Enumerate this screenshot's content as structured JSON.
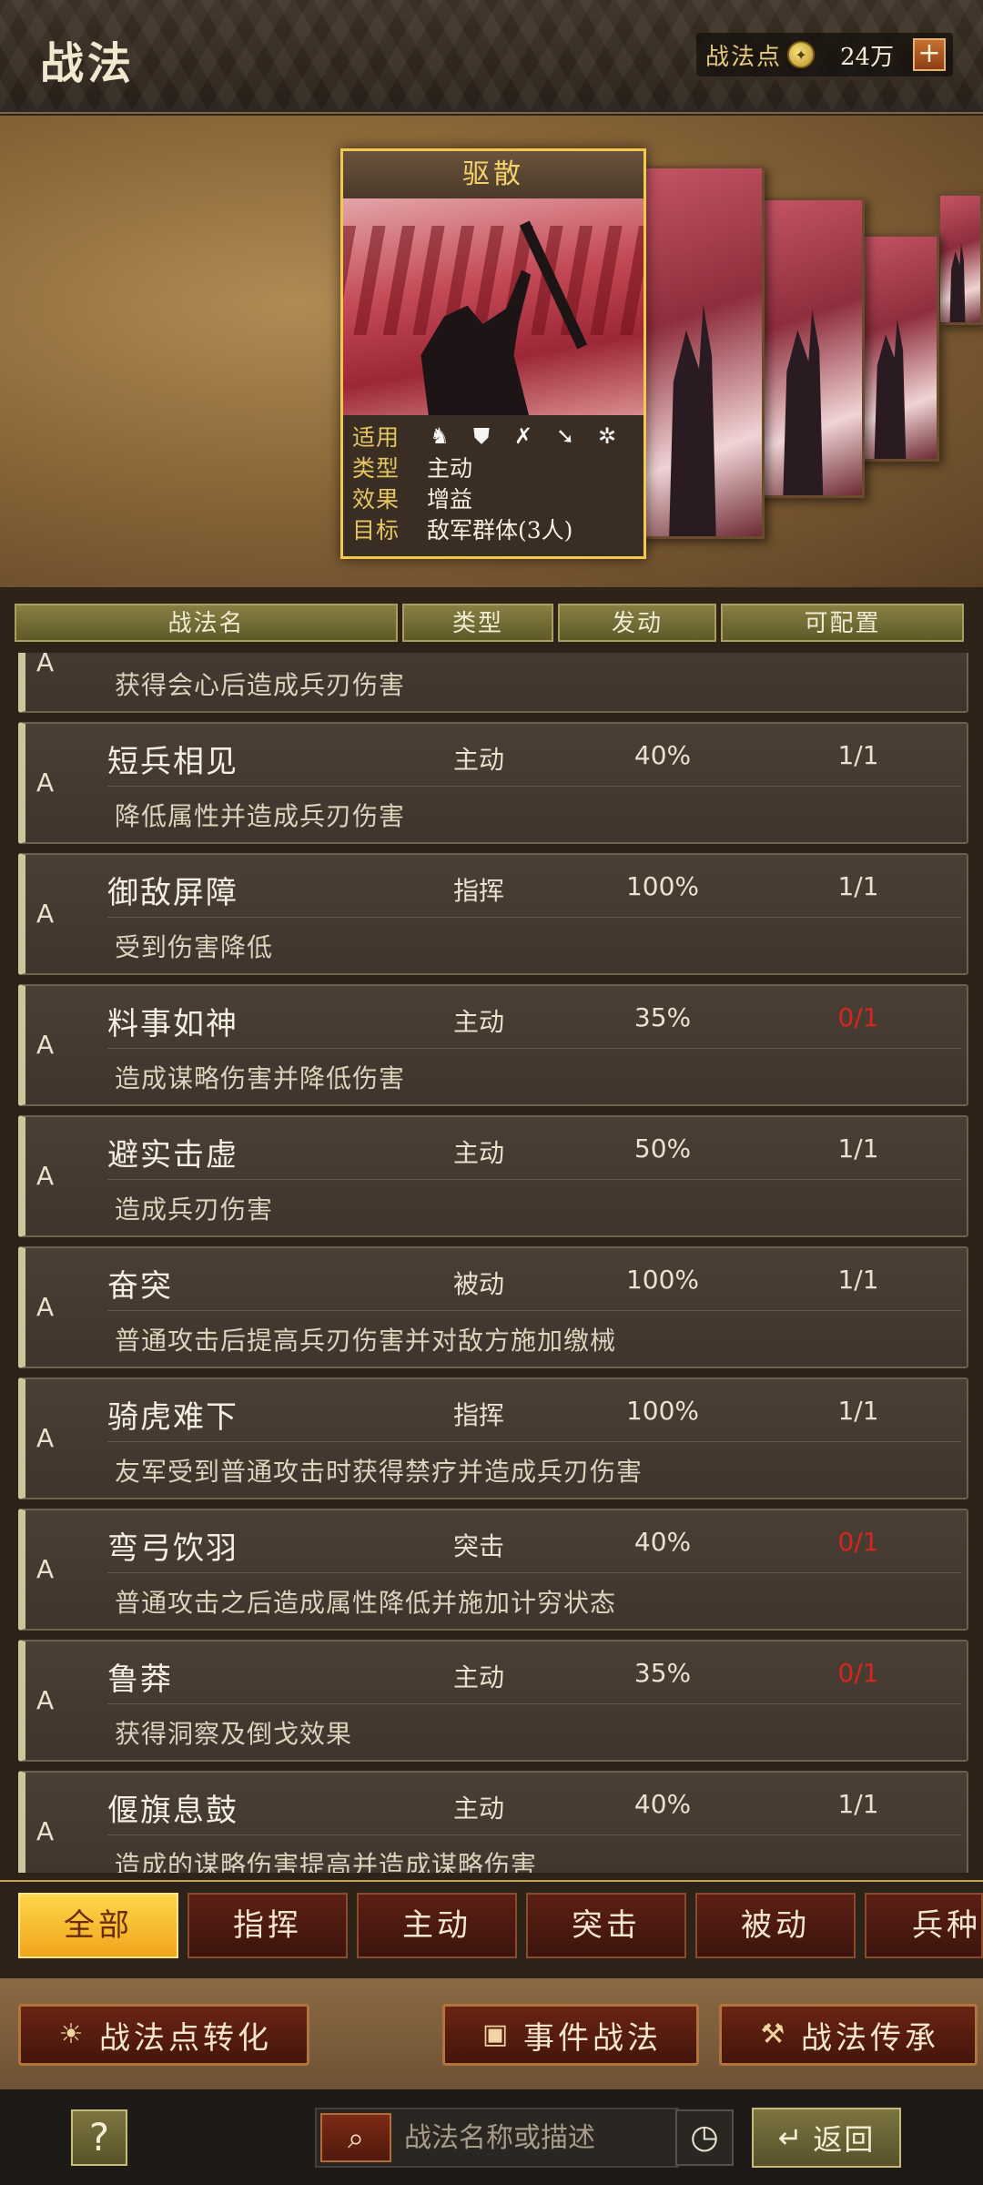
{
  "header": {
    "title": "战法",
    "points_label": "战法点",
    "points_value": "24万",
    "plus_label": "+"
  },
  "card": {
    "name": "驱散",
    "applicable_key": "适用",
    "type_key": "类型",
    "type_value": "主动",
    "effect_key": "效果",
    "effect_value": "增益",
    "target_key": "目标",
    "target_value": "敌军群体(3人)",
    "unit_icons": [
      "cavalry-icon",
      "shield-icon",
      "bow-icon",
      "spear-icon",
      "wheel-icon"
    ]
  },
  "table": {
    "headers": [
      "战法名",
      "类型",
      "发动",
      "可配置"
    ],
    "partial_row": {
      "grade": "A",
      "desc": "获得会心后造成兵刃伤害"
    },
    "rows": [
      {
        "grade": "A",
        "name": "短兵相见",
        "type": "主动",
        "rate": "40%",
        "slots": "1/1",
        "desc": "降低属性并造成兵刃伤害",
        "empty": false
      },
      {
        "grade": "A",
        "name": "御敌屏障",
        "type": "指挥",
        "rate": "100%",
        "slots": "1/1",
        "desc": "受到伤害降低",
        "empty": false
      },
      {
        "grade": "A",
        "name": "料事如神",
        "type": "主动",
        "rate": "35%",
        "slots": "0/1",
        "desc": "造成谋略伤害并降低伤害",
        "empty": true
      },
      {
        "grade": "A",
        "name": "避实击虚",
        "type": "主动",
        "rate": "50%",
        "slots": "1/1",
        "desc": "造成兵刃伤害",
        "empty": false
      },
      {
        "grade": "A",
        "name": "奋突",
        "type": "被动",
        "rate": "100%",
        "slots": "1/1",
        "desc": "普通攻击后提高兵刃伤害并对敌方施加缴械",
        "empty": false
      },
      {
        "grade": "A",
        "name": "骑虎难下",
        "type": "指挥",
        "rate": "100%",
        "slots": "1/1",
        "desc": "友军受到普通攻击时获得禁疗并造成兵刃伤害",
        "empty": false
      },
      {
        "grade": "A",
        "name": "弯弓饮羽",
        "type": "突击",
        "rate": "40%",
        "slots": "0/1",
        "desc": "普通攻击之后造成属性降低并施加计穷状态",
        "empty": true
      },
      {
        "grade": "A",
        "name": "鲁莽",
        "type": "主动",
        "rate": "35%",
        "slots": "0/1",
        "desc": "获得洞察及倒戈效果",
        "empty": true
      },
      {
        "grade": "A",
        "name": "偃旗息鼓",
        "type": "主动",
        "rate": "40%",
        "slots": "1/1",
        "desc": "造成的谋略伤害提高并造成谋略伤害",
        "empty": false
      }
    ]
  },
  "tabs": {
    "items": [
      "全部",
      "指挥",
      "主动",
      "突击",
      "被动",
      "兵种"
    ],
    "active": "全部"
  },
  "actions": {
    "convert_label": "战法点转化",
    "event_label": "事件战法",
    "inherit_label": "战法传承"
  },
  "bottom": {
    "help_label": "?",
    "search_placeholder": "战法名称或描述",
    "back_label": "返回"
  },
  "colors": {
    "accent_gold": "#f2c94c",
    "slot_empty_red": "#d8251e",
    "tab_active": "#ffd64a"
  }
}
